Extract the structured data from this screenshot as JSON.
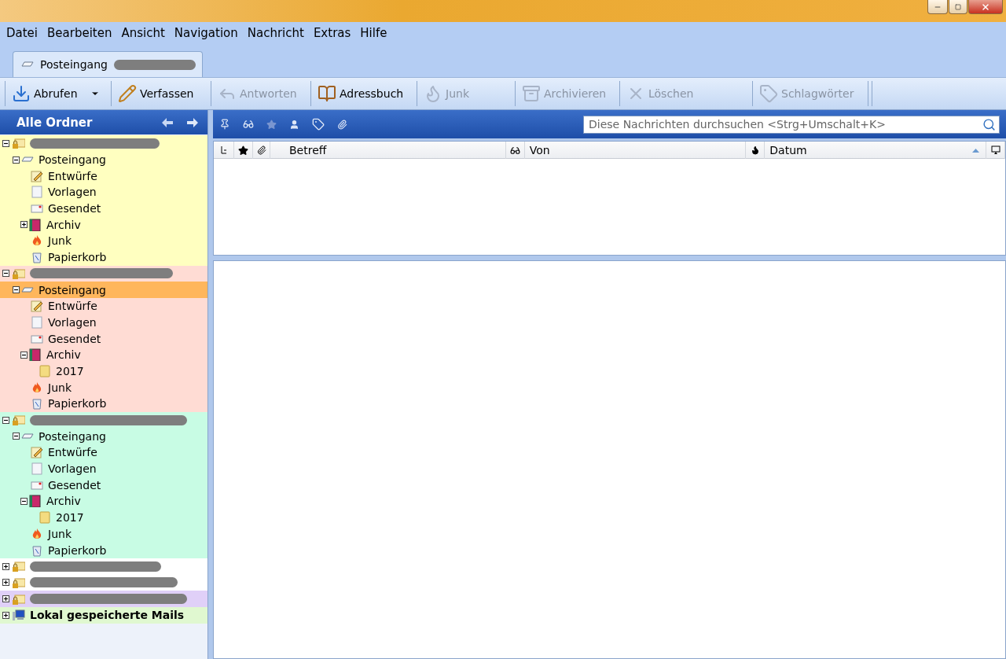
{
  "menu": [
    {
      "label": "Datei"
    },
    {
      "label": "Bearbeiten"
    },
    {
      "label": "Ansicht"
    },
    {
      "label": "Navigation"
    },
    {
      "label": "Nachricht"
    },
    {
      "label": "Extras"
    },
    {
      "label": "Hilfe"
    }
  ],
  "tabs": [
    {
      "label": "Posteingang",
      "selected": true,
      "redacted": true
    }
  ],
  "toolbar": [
    {
      "label": "Abrufen",
      "kind": "fetch",
      "disabled": false,
      "dropdown": true
    },
    {
      "label": "Verfassen",
      "kind": "compose",
      "disabled": false,
      "dropdown": false
    },
    {
      "label": "Antworten",
      "kind": "reply",
      "disabled": true,
      "dropdown": false
    },
    {
      "label": "Adressbuch",
      "kind": "addressbook",
      "disabled": false,
      "dropdown": false
    },
    {
      "label": "Junk",
      "kind": "junk",
      "disabled": true,
      "dropdown": false
    },
    {
      "label": "Archivieren",
      "kind": "archive",
      "disabled": true,
      "dropdown": false
    },
    {
      "label": "Löschen",
      "kind": "delete",
      "disabled": true,
      "dropdown": false
    },
    {
      "label": "Schlagwörter",
      "kind": "tag",
      "disabled": true,
      "dropdown": false
    }
  ],
  "folder_pane": {
    "title": "Alle Ordner",
    "accounts": [
      {
        "kind": "redacted",
        "color": "#ffffc0",
        "expanded": true,
        "children": [
          {
            "label": "Posteingang",
            "kind": "inbox",
            "selected": false,
            "expanded": true,
            "children": [
              {
                "label": "Entwürfe",
                "kind": "drafts",
                "selected": false
              },
              {
                "label": "Vorlagen",
                "kind": "templates",
                "selected": false
              },
              {
                "label": "Gesendet",
                "kind": "sent",
                "selected": false
              },
              {
                "label": "Archiv",
                "kind": "archive",
                "selected": false,
                "expanded": false
              },
              {
                "label": "Junk",
                "kind": "junk",
                "selected": false
              },
              {
                "label": "Papierkorb",
                "kind": "trash",
                "selected": false
              }
            ]
          }
        ]
      },
      {
        "kind": "redacted",
        "color": "#ffdcd4",
        "expanded": true,
        "children": [
          {
            "label": "Posteingang",
            "kind": "inbox",
            "selected": true,
            "expanded": true,
            "children": [
              {
                "label": "Entwürfe",
                "kind": "drafts",
                "selected": false
              },
              {
                "label": "Vorlagen",
                "kind": "templates",
                "selected": false
              },
              {
                "label": "Gesendet",
                "kind": "sent",
                "selected": false
              },
              {
                "label": "Archiv",
                "kind": "archive",
                "selected": false,
                "expanded": true,
                "children": [
                  {
                    "label": "2017",
                    "kind": "folder",
                    "selected": false
                  }
                ]
              },
              {
                "label": "Junk",
                "kind": "junk",
                "selected": false
              },
              {
                "label": "Papierkorb",
                "kind": "trash",
                "selected": false
              }
            ]
          }
        ]
      },
      {
        "kind": "redacted",
        "color": "#c8fce4",
        "expanded": true,
        "children": [
          {
            "label": "Posteingang",
            "kind": "inbox",
            "selected": false,
            "expanded": true,
            "children": [
              {
                "label": "Entwürfe",
                "kind": "drafts",
                "selected": false
              },
              {
                "label": "Vorlagen",
                "kind": "templates",
                "selected": false
              },
              {
                "label": "Gesendet",
                "kind": "sent",
                "selected": false
              },
              {
                "label": "Archiv",
                "kind": "archive",
                "selected": false,
                "expanded": true,
                "children": [
                  {
                    "label": "2017",
                    "kind": "folder",
                    "selected": false
                  }
                ]
              },
              {
                "label": "Junk",
                "kind": "junk",
                "selected": false
              },
              {
                "label": "Papierkorb",
                "kind": "trash",
                "selected": false
              }
            ]
          }
        ]
      },
      {
        "kind": "redacted",
        "color": "#ffffff",
        "expanded": false
      },
      {
        "kind": "redacted",
        "color": "#ffffff",
        "expanded": false
      },
      {
        "kind": "redacted",
        "color": "#e0d0f8",
        "expanded": false
      },
      {
        "kind": "local",
        "label": "Lokal gespeicherte Mails",
        "color": "#e0f8d0",
        "expanded": false
      }
    ]
  },
  "search": {
    "placeholder": "Diese Nachrichten durchsuchen <Strg+Umschalt+K>"
  },
  "message_list": {
    "columns": [
      {
        "kind": "thread"
      },
      {
        "kind": "star"
      },
      {
        "kind": "attachment"
      },
      {
        "kind": "text",
        "label": "Betreff"
      },
      {
        "kind": "read"
      },
      {
        "kind": "text",
        "label": "Von"
      },
      {
        "kind": "junk"
      },
      {
        "kind": "text",
        "label": "Datum",
        "sorted": true
      },
      {
        "kind": "picker"
      }
    ]
  }
}
